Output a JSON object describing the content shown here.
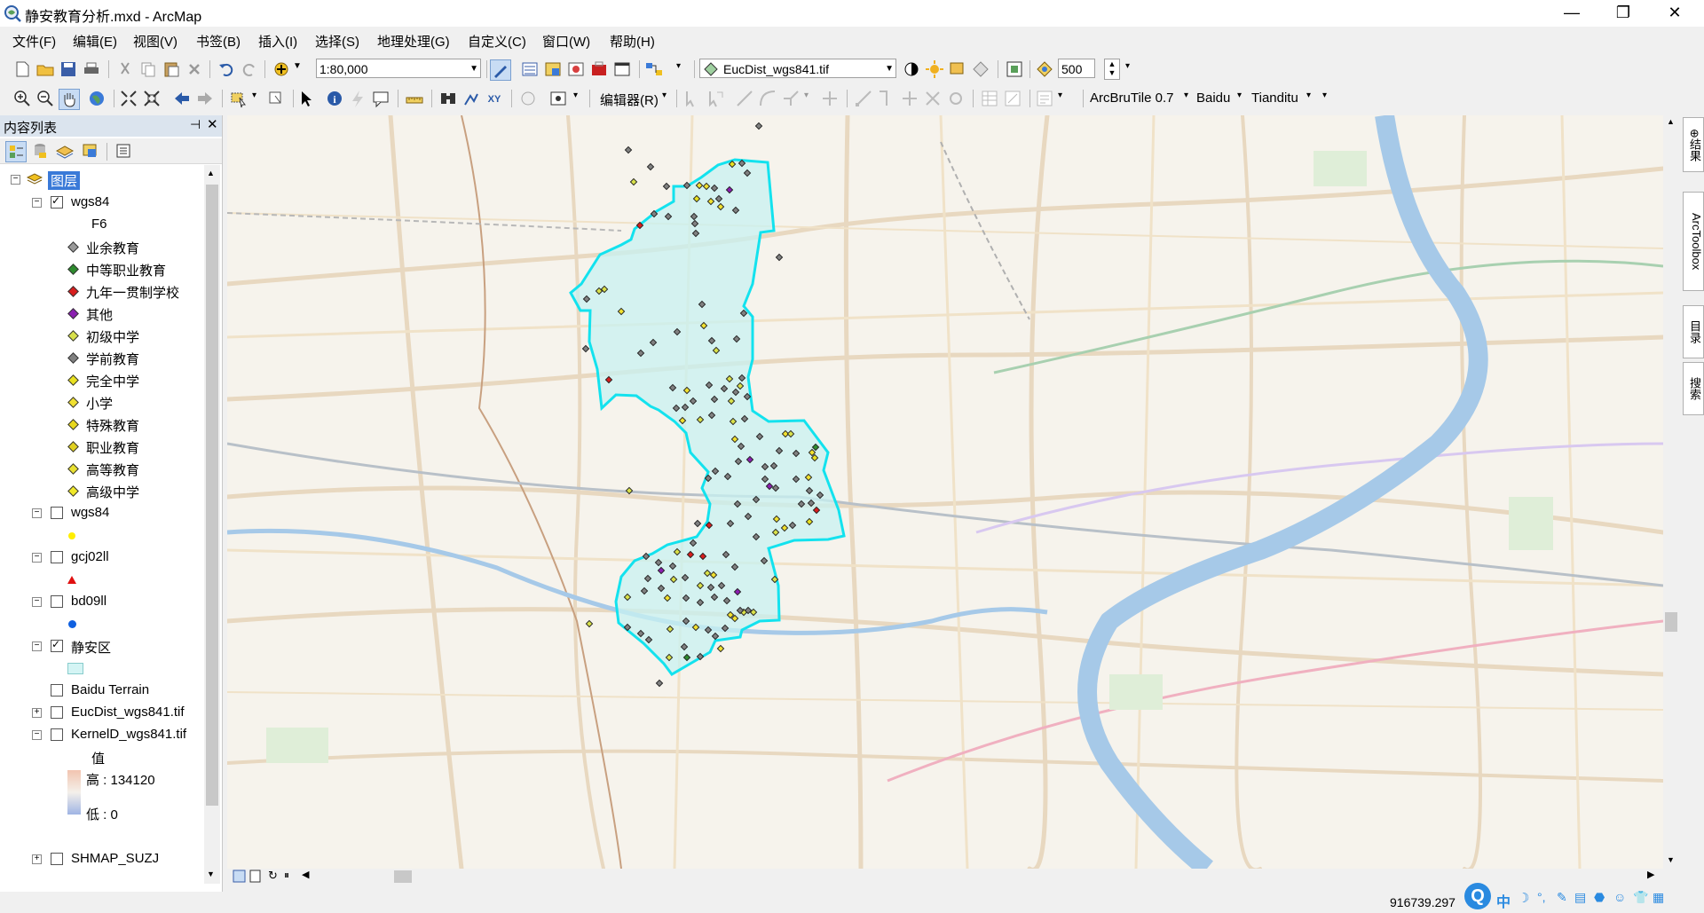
{
  "window": {
    "title": "静安教育分析.mxd - ArcMap",
    "controls": {
      "minimize": "—",
      "restore": "❐",
      "close": "✕"
    }
  },
  "menu": [
    "文件(F)",
    "编辑(E)",
    "视图(V)",
    "书签(B)",
    "插入(I)",
    "选择(S)",
    "地理处理(G)",
    "自定义(C)",
    "窗口(W)",
    "帮助(H)"
  ],
  "toolbar": {
    "scale": "1:80,000",
    "layer_combo": "EucDist_wgs841.tif",
    "brightness_value": "500",
    "editor_label": "编辑器(R)",
    "arcbrutile_label": "ArcBruTile 0.7",
    "baidu_label": "Baidu",
    "tianditu_label": "Tianditu"
  },
  "toc": {
    "title": "内容列表",
    "root": "图层",
    "layers": [
      {
        "name": "wgs84",
        "checked": true,
        "expanded": true,
        "field": "F6",
        "categories": [
          {
            "label": "业余教育",
            "color": "#9a9a9a"
          },
          {
            "label": "中等职业教育",
            "color": "#2e8b2e"
          },
          {
            "label": "九年一贯制学校",
            "color": "#d81e1e"
          },
          {
            "label": "其他",
            "color": "#8a1fb0"
          },
          {
            "label": "初级中学",
            "color": "#d8e04a"
          },
          {
            "label": "学前教育",
            "color": "#808080"
          },
          {
            "label": "完全中学",
            "color": "#e8e020"
          },
          {
            "label": "小学",
            "color": "#f0e030"
          },
          {
            "label": "特殊教育",
            "color": "#e8d81c"
          },
          {
            "label": "职业教育",
            "color": "#e0d020"
          },
          {
            "label": "高等教育",
            "color": "#e8e030"
          },
          {
            "label": "高级中学",
            "color": "#f0e828"
          }
        ]
      },
      {
        "name": "wgs84",
        "checked": false,
        "expanded": true,
        "symbol": "yellow-dot"
      },
      {
        "name": "gcj02ll",
        "checked": false,
        "expanded": true,
        "symbol": "red-triangle"
      },
      {
        "name": "bd09ll",
        "checked": false,
        "expanded": true,
        "symbol": "blue-dot"
      },
      {
        "name": "静安区",
        "checked": true,
        "expanded": true,
        "symbol": "polygon"
      },
      {
        "name": "Baidu Terrain",
        "checked": false
      },
      {
        "name": "EucDist_wgs841.tif",
        "checked": false,
        "expanded": false
      },
      {
        "name": "KernelD_wgs841.tif",
        "checked": false,
        "expanded": true,
        "legend_title": "值",
        "high": "高 : 134120",
        "low": "低 : 0"
      },
      {
        "name": "SHMAP_SUZJ",
        "checked": false,
        "expanded": false
      }
    ]
  },
  "map": {
    "district_fill": "#c8f2f2",
    "district_outline": "#13e2ee",
    "river_color": "#a6c9e8",
    "points": [
      [
        855,
        142,
        "学前教育"
      ],
      [
        708,
        169,
        "学前教育"
      ],
      [
        733,
        188,
        "学前教育"
      ],
      [
        714,
        205,
        "初级中学"
      ],
      [
        751,
        210,
        "学前教育"
      ],
      [
        774,
        209,
        "学前教育"
      ],
      [
        788,
        209,
        "小学"
      ],
      [
        796,
        210,
        "小学"
      ],
      [
        805,
        212,
        "学前教育"
      ],
      [
        822,
        214,
        "其他"
      ],
      [
        836,
        184,
        "学前教育"
      ],
      [
        825,
        185,
        "完全中学"
      ],
      [
        842,
        195,
        "学前教育"
      ],
      [
        785,
        224,
        "完全中学"
      ],
      [
        801,
        227,
        "小学"
      ],
      [
        810,
        224,
        "学前教育"
      ],
      [
        829,
        237,
        "学前教育"
      ],
      [
        812,
        233,
        "小学"
      ],
      [
        782,
        244,
        "学前教育"
      ],
      [
        737,
        241,
        "学前教育"
      ],
      [
        753,
        244,
        "学前教育"
      ],
      [
        721,
        254,
        "九年一贯制学校"
      ],
      [
        783,
        252,
        "学前教育"
      ],
      [
        784,
        263,
        "学前教育"
      ],
      [
        878,
        290,
        "学前教育"
      ],
      [
        675,
        328,
        "初级中学"
      ],
      [
        681,
        326,
        "初级中学"
      ],
      [
        661,
        337,
        "学前教育"
      ],
      [
        700,
        351,
        "小学"
      ],
      [
        791,
        343,
        "学前教育"
      ],
      [
        793,
        367,
        "小学"
      ],
      [
        763,
        374,
        "学前教育"
      ],
      [
        736,
        386,
        "学前教育"
      ],
      [
        802,
        384,
        "学前教育"
      ],
      [
        830,
        382,
        "学前教育"
      ],
      [
        838,
        353,
        "学前教育"
      ],
      [
        807,
        395,
        "初级中学"
      ],
      [
        660,
        393,
        "学前教育"
      ],
      [
        722,
        398,
        "学前教育"
      ],
      [
        686,
        428,
        "九年一贯制学校"
      ],
      [
        758,
        437,
        "学前教育"
      ],
      [
        774,
        440,
        "小学"
      ],
      [
        799,
        434,
        "学前教育"
      ],
      [
        816,
        438,
        "学前教育"
      ],
      [
        822,
        427,
        "初级中学"
      ],
      [
        834,
        435,
        "初级中学"
      ],
      [
        836,
        426,
        "学前教育"
      ],
      [
        829,
        442,
        "学前教育"
      ],
      [
        842,
        447,
        "学前教育"
      ],
      [
        781,
        452,
        "学前教育"
      ],
      [
        805,
        450,
        "学前教育"
      ],
      [
        824,
        452,
        "初级中学"
      ],
      [
        762,
        460,
        "学前教育"
      ],
      [
        772,
        459,
        "学前教育"
      ],
      [
        769,
        474,
        "小学"
      ],
      [
        789,
        473,
        "初级中学"
      ],
      [
        802,
        468,
        "学前教育"
      ],
      [
        826,
        475,
        "初级中学"
      ],
      [
        839,
        472,
        "学前教育"
      ],
      [
        856,
        492,
        "学前教育"
      ],
      [
        885,
        489,
        "小学"
      ],
      [
        891,
        489,
        "初级中学"
      ],
      [
        828,
        495,
        "小学"
      ],
      [
        835,
        503,
        "学前教育"
      ],
      [
        919,
        504,
        "中等职业教育"
      ],
      [
        897,
        511,
        "学前教育"
      ],
      [
        915,
        510,
        "小学"
      ],
      [
        878,
        508,
        "学前教育"
      ],
      [
        832,
        520,
        "学前教育"
      ],
      [
        845,
        518,
        "其他"
      ],
      [
        806,
        531,
        "学前教育"
      ],
      [
        862,
        526,
        "学前教育"
      ],
      [
        872,
        525,
        "学前教育"
      ],
      [
        918,
        516,
        "完全中学"
      ],
      [
        820,
        537,
        "学前教育"
      ],
      [
        798,
        539,
        "学前教育"
      ],
      [
        709,
        553,
        "初级中学"
      ],
      [
        862,
        540,
        "学前教育"
      ],
      [
        867,
        548,
        "其他"
      ],
      [
        874,
        550,
        "学前教育"
      ],
      [
        897,
        540,
        "学前教育"
      ],
      [
        911,
        538,
        "小学"
      ],
      [
        912,
        553,
        "学前教育"
      ],
      [
        903,
        568,
        "学前教育"
      ],
      [
        914,
        567,
        "学前教育"
      ],
      [
        924,
        558,
        "学前教育"
      ],
      [
        920,
        575,
        "九年一贯制学校"
      ],
      [
        852,
        563,
        "学前教育"
      ],
      [
        831,
        568,
        "学前教育"
      ],
      [
        786,
        590,
        "学前教育"
      ],
      [
        799,
        592,
        "九年一贯制学校"
      ],
      [
        823,
        590,
        "学前教育"
      ],
      [
        843,
        582,
        "学前教育"
      ],
      [
        875,
        585,
        "小学"
      ],
      [
        884,
        595,
        "小学"
      ],
      [
        893,
        592,
        "学前教育"
      ],
      [
        912,
        588,
        "完全中学"
      ],
      [
        874,
        600,
        "初级中学"
      ],
      [
        852,
        605,
        "学前教育"
      ],
      [
        781,
        612,
        "学前教育"
      ],
      [
        763,
        622,
        "初级中学"
      ],
      [
        792,
        627,
        "九年一贯制学校"
      ],
      [
        778,
        625,
        "九年一贯制学校"
      ],
      [
        818,
        625,
        "学前教育"
      ],
      [
        728,
        627,
        "学前教育"
      ],
      [
        742,
        634,
        "学前教育"
      ],
      [
        758,
        638,
        "学前教育"
      ],
      [
        745,
        643,
        "其他"
      ],
      [
        797,
        646,
        "初级中学"
      ],
      [
        804,
        648,
        "小学"
      ],
      [
        828,
        639,
        "学前教育"
      ],
      [
        861,
        632,
        "学前教育"
      ],
      [
        730,
        652,
        "学前教育"
      ],
      [
        759,
        653,
        "初级中学"
      ],
      [
        772,
        651,
        "学前教育"
      ],
      [
        789,
        660,
        "初级中学"
      ],
      [
        801,
        662,
        "学前教育"
      ],
      [
        813,
        660,
        "学前教育"
      ],
      [
        831,
        667,
        "其他"
      ],
      [
        873,
        653,
        "初级中学"
      ],
      [
        707,
        673,
        "初级中学"
      ],
      [
        726,
        666,
        "学前教育"
      ],
      [
        745,
        663,
        "学前教育"
      ],
      [
        752,
        674,
        "小学"
      ],
      [
        773,
        674,
        "学前教育"
      ],
      [
        789,
        679,
        "学前教育"
      ],
      [
        805,
        673,
        "学前教育"
      ],
      [
        819,
        677,
        "学前教育"
      ],
      [
        838,
        690,
        "初级中学"
      ],
      [
        828,
        697,
        "小学"
      ],
      [
        834,
        688,
        "学前教育"
      ],
      [
        843,
        688,
        "学前教育"
      ],
      [
        849,
        690,
        "初级中学"
      ],
      [
        823,
        693,
        "小学"
      ],
      [
        817,
        708,
        "学前教育"
      ],
      [
        664,
        703,
        "初级中学"
      ],
      [
        707,
        707,
        "学前教育"
      ],
      [
        722,
        714,
        "学前教育"
      ],
      [
        731,
        721,
        "学前教育"
      ],
      [
        755,
        709,
        "初级中学"
      ],
      [
        773,
        700,
        "学前教育"
      ],
      [
        784,
        707,
        "小学"
      ],
      [
        798,
        710,
        "学前教育"
      ],
      [
        806,
        717,
        "学前教育"
      ],
      [
        771,
        729,
        "学前教育"
      ],
      [
        789,
        740,
        "学前教育"
      ],
      [
        774,
        741,
        "中等职业教育"
      ],
      [
        754,
        741,
        "初级中学"
      ],
      [
        812,
        731,
        "小学"
      ],
      [
        743,
        770,
        "学前教育"
      ]
    ]
  },
  "statusbar": {
    "coords": "916739.297"
  }
}
